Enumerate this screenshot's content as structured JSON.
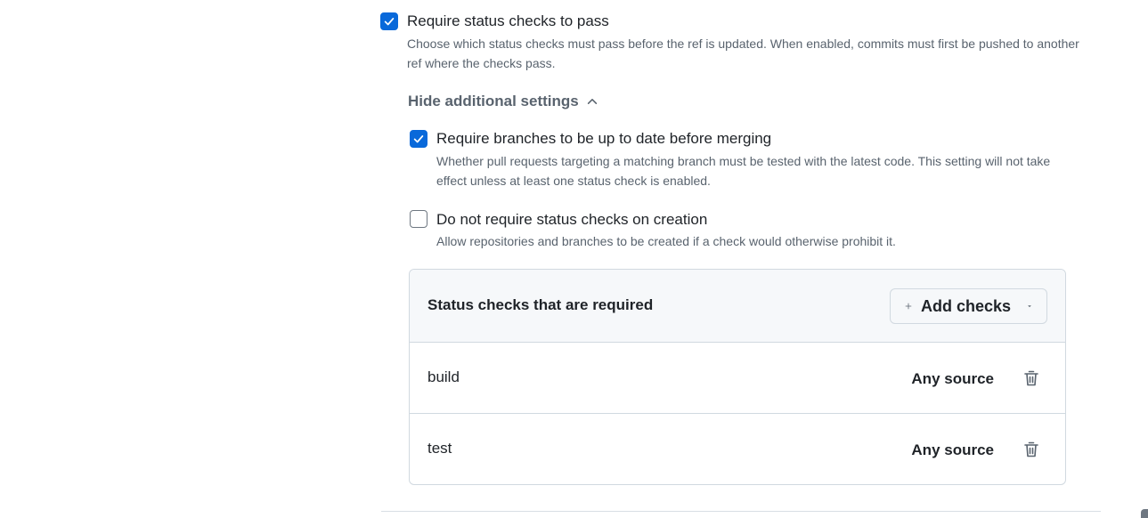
{
  "status_checks": {
    "label": "Require status checks to pass",
    "checked": true,
    "description": "Choose which status checks must pass before the ref is updated. When enabled, commits must first be pushed to another ref where the checks pass."
  },
  "additional_settings_toggle": {
    "label": "Hide additional settings",
    "icon": "chevron-up-icon"
  },
  "up_to_date": {
    "label": "Require branches to be up to date before merging",
    "checked": true,
    "description": "Whether pull requests targeting a matching branch must be tested with the latest code. This setting will not take effect unless at least one status check is enabled."
  },
  "not_on_creation": {
    "label": "Do not require status checks on creation",
    "checked": false,
    "description": "Allow repositories and branches to be created if a check would otherwise prohibit it."
  },
  "required_checks": {
    "title": "Status checks that are required",
    "add_button_label": "Add checks",
    "add_icon": "plus-icon",
    "dropdown_icon": "caret-down-icon",
    "rows": [
      {
        "name": "build",
        "source": "Any source",
        "delete_icon": "trash-icon"
      },
      {
        "name": "test",
        "source": "Any source",
        "delete_icon": "trash-icon"
      }
    ]
  },
  "colors": {
    "accent": "#0969da",
    "muted_text": "#59636e",
    "border": "#d1d9e0",
    "header_bg": "#f6f8fa"
  }
}
